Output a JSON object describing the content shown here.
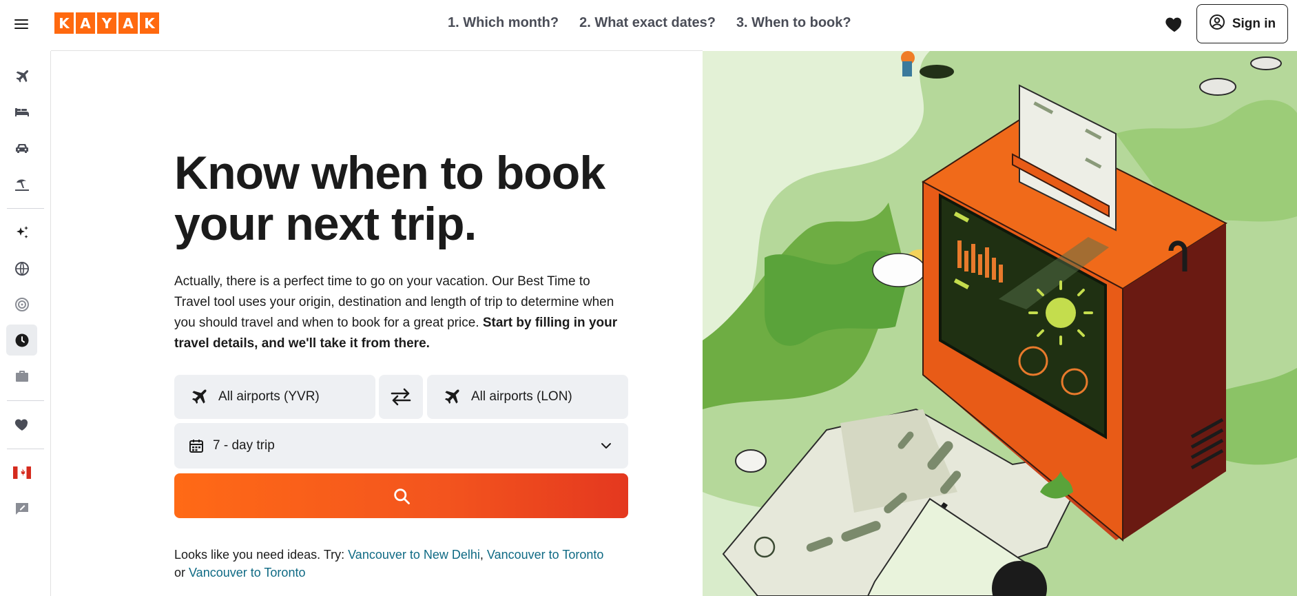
{
  "header": {
    "logo_letters": [
      "K",
      "A",
      "Y",
      "A",
      "K"
    ],
    "nav": [
      "1. Which month?",
      "2. What exact dates?",
      "3. When to book?"
    ],
    "signin_label": "Sign in",
    "icons": [
      "menu-icon",
      "heart-icon",
      "user-icon"
    ]
  },
  "sidebar": {
    "items": [
      {
        "name": "flights",
        "icon": "plane-icon"
      },
      {
        "name": "stays",
        "icon": "bed-icon"
      },
      {
        "name": "cars",
        "icon": "car-icon"
      },
      {
        "name": "packages",
        "icon": "beach-icon"
      },
      {
        "name": "ai-assistant",
        "icon": "sparkle-icon"
      },
      {
        "name": "explore",
        "icon": "globe-icon"
      },
      {
        "name": "trends",
        "icon": "target-icon"
      },
      {
        "name": "best-time",
        "icon": "clock-icon",
        "active": true
      },
      {
        "name": "business",
        "icon": "briefcase-icon"
      },
      {
        "name": "trips",
        "icon": "heart-icon"
      },
      {
        "name": "region",
        "icon": "canada-flag-icon"
      },
      {
        "name": "feedback",
        "icon": "feedback-icon"
      }
    ]
  },
  "hero": {
    "title_line1": "Know when to book",
    "title_line2": "your next trip.",
    "desc_plain": "Actually, there is a perfect time to go on your vacation. Our Best Time to Travel tool uses your origin, destination and length of trip to determine when you should travel and when to book for a great price. ",
    "desc_bold": "Start by filling in your travel details, and we'll take it from there."
  },
  "form": {
    "origin": "All airports (YVR)",
    "destination": "All airports (LON)",
    "trip_length": "7 - day trip"
  },
  "ideas": {
    "prefix": "Looks like you need ideas. Try: ",
    "link1": "Vancouver to New Delhi",
    "sep1": ", ",
    "link2": "Vancouver to Toronto",
    "sep2": " or ",
    "link3": "Vancouver to Toronto"
  },
  "colors": {
    "brand": "#ff690f",
    "link": "#0f6a84",
    "field_bg": "#eef0f3",
    "illus_bg": "#b5d89a"
  }
}
